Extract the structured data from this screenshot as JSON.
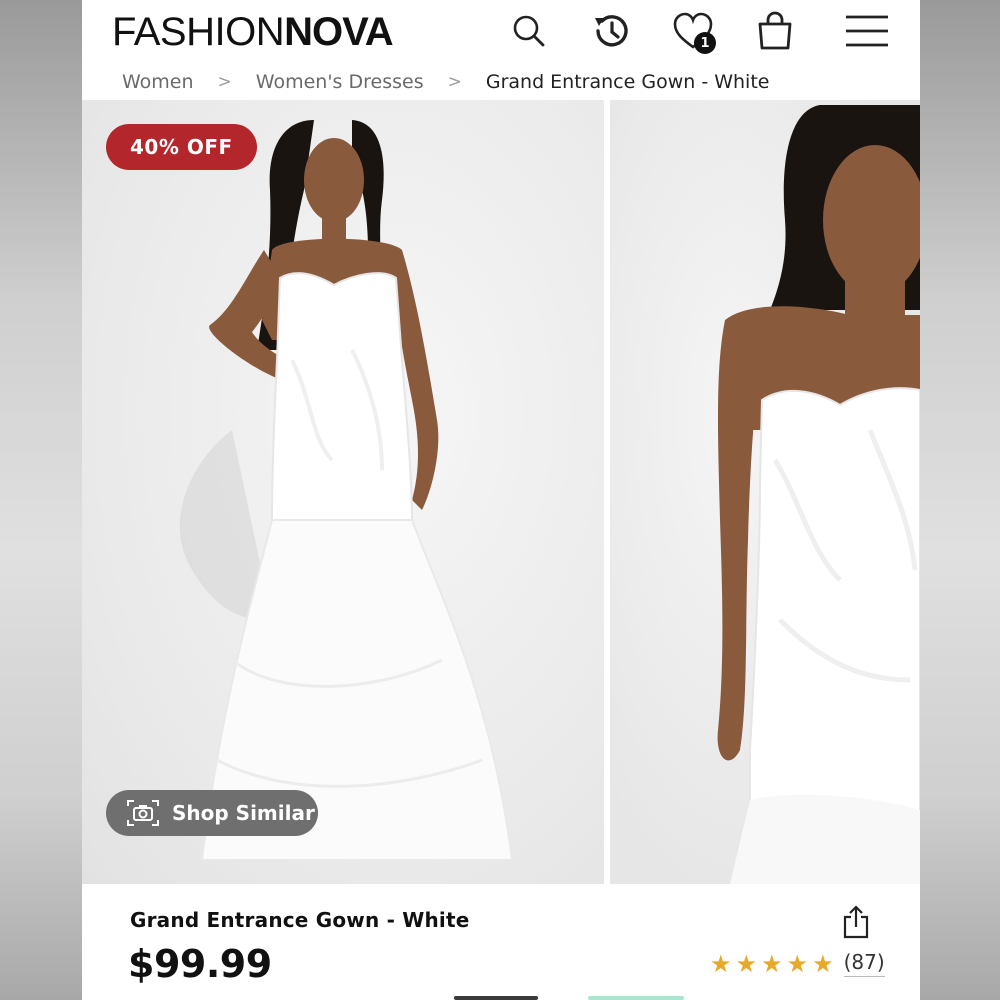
{
  "header": {
    "logo_thin": "FASHION",
    "logo_bold": "NOVA",
    "wishlist_count": "1"
  },
  "breadcrumb": {
    "items": [
      "Women",
      "Women's Dresses",
      "Grand Entrance Gown - White"
    ]
  },
  "gallery": {
    "sale_badge": "40% OFF",
    "shop_similar_label": "Shop Similar"
  },
  "product": {
    "title": "Grand Entrance Gown - White",
    "price": "$99.99",
    "rating_stars": 5,
    "review_count": "(87)"
  },
  "colors": {
    "sale": "#b3262b",
    "star": "#e8a92a",
    "text": "#111111"
  }
}
